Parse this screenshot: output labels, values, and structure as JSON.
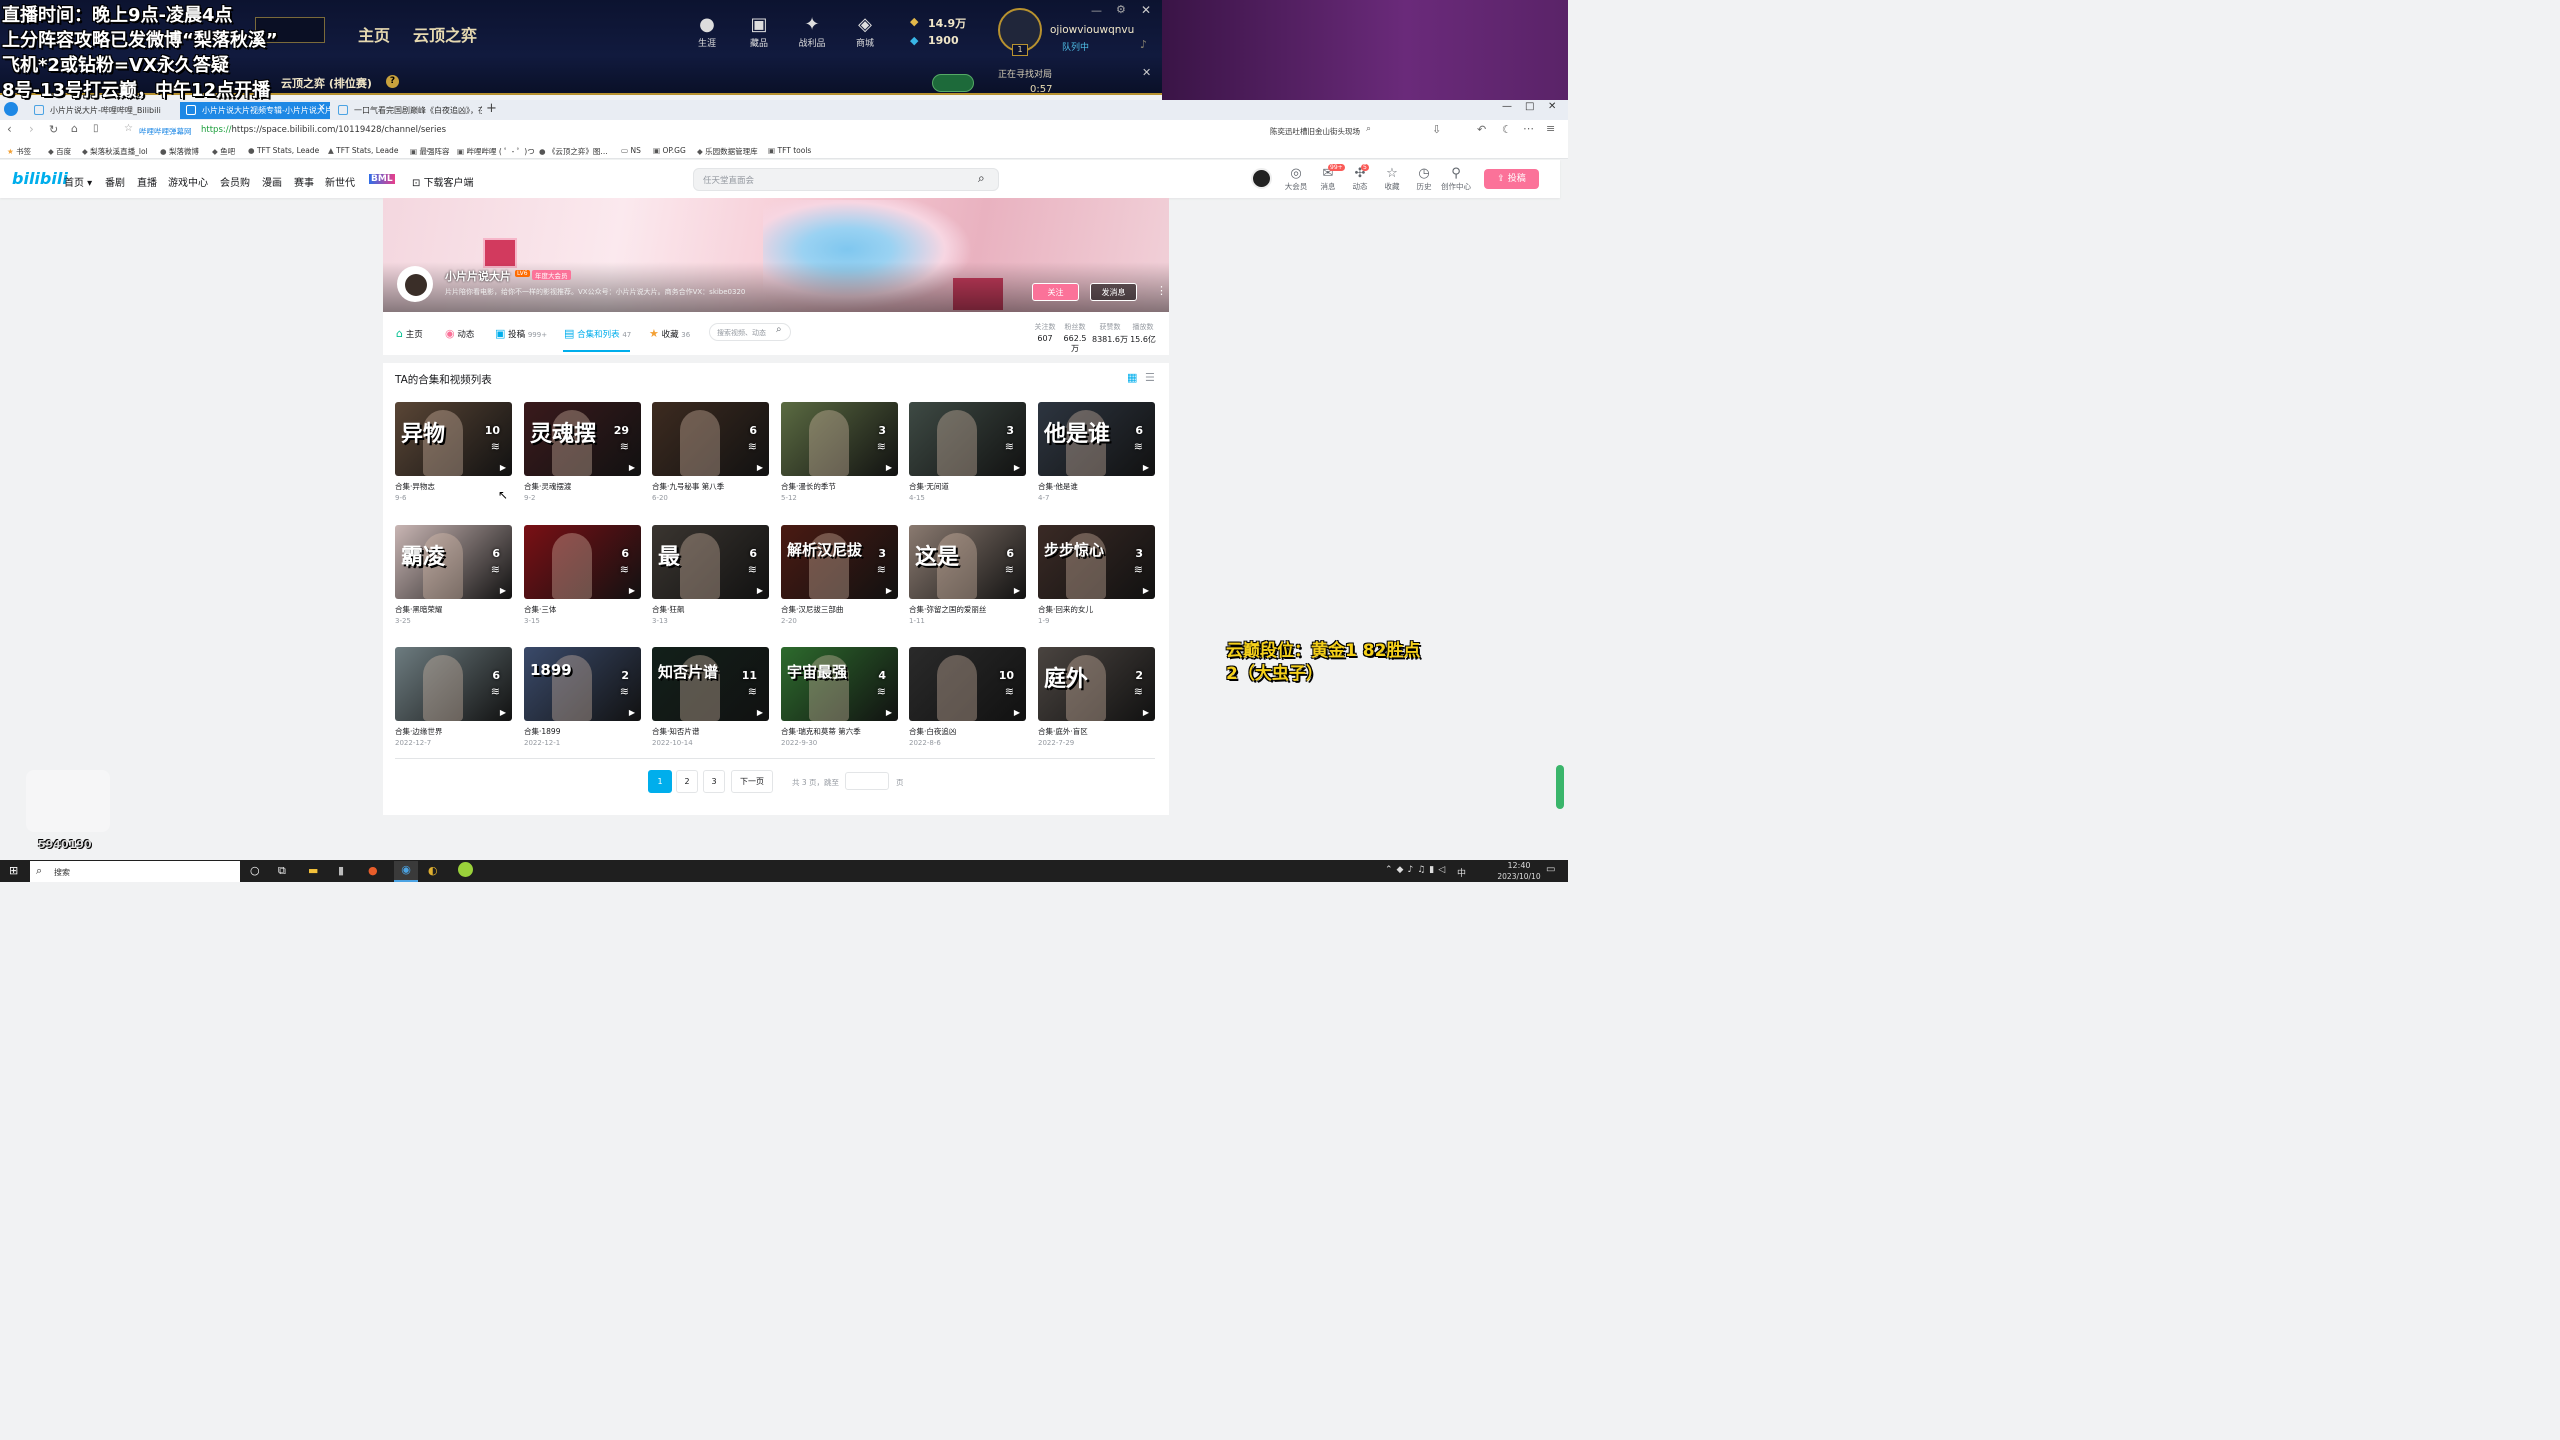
{
  "overlay": {
    "line1": "直播时间：晚上9点-凌晨4点",
    "line2": "上分阵容攻略已发微博“梨落秋溪”",
    "line3": "飞机*2或钻粉=VX永久答疑",
    "line4": "8号-13号打云巅，中午12点开播",
    "rank": "云巅段位：黄金1 82胜点",
    "rank2": "2（大虫子）",
    "watermark_num": "5940190"
  },
  "game": {
    "nav": [
      "主页",
      "云顶之弈"
    ],
    "icons": [
      {
        "label": "生涯",
        "icon": "person-icon"
      },
      {
        "label": "藏品",
        "icon": "chest-icon"
      },
      {
        "label": "战利品",
        "icon": "loot-icon"
      },
      {
        "label": "商城",
        "icon": "shop-icon"
      }
    ],
    "currency1": "14.9万",
    "currency2": "1900",
    "username": "ojiowviouwqnvu",
    "status": "队列中",
    "level": "1",
    "mode": "云顶之弈 (排位赛)",
    "searching": "正在寻找对局",
    "timer": "0:57"
  },
  "browser": {
    "tabs": [
      "小片片说大片-哔哩哔哩_Bilibili",
      "小片片说大片视频专辑-小片片说大片",
      "一口气看完国剧巅峰《白夜追凶》，在..."
    ],
    "site_label": "哔哩哔哩弹幕网",
    "url": "https://space.bilibili.com/10119428/channel/series",
    "search_hint": "陈奕迅吐槽旧金山街头现场",
    "bookmarks": [
      "书签",
      "百度",
      "梨落秋溪直播_lol",
      "梨落微博",
      "鱼吧",
      "TFT Stats, Leade",
      "TFT Stats, Leade",
      "最强阵容",
      "哔哩哔哩 ( ゜- ゜)つ",
      "《云顶之弈》图...",
      "NS",
      "OP.GG",
      "乐园数据管理库",
      "TFT tools"
    ]
  },
  "bili": {
    "logo": "bilibili",
    "nav": [
      "首页",
      "番剧",
      "直播",
      "游戏中心",
      "会员购",
      "漫画",
      "赛事",
      "新世代",
      "BML",
      "下载客户端"
    ],
    "search_placeholder": "任天堂直面会",
    "icons": [
      {
        "label": "大会员",
        "icon": "vip-icon"
      },
      {
        "label": "消息",
        "icon": "message-icon",
        "badge": "99+"
      },
      {
        "label": "动态",
        "icon": "dynamic-icon",
        "badge": "5"
      },
      {
        "label": "收藏",
        "icon": "star-icon"
      },
      {
        "label": "历史",
        "icon": "history-icon"
      },
      {
        "label": "创作中心",
        "icon": "creator-icon"
      }
    ],
    "upload": "投稿"
  },
  "profile": {
    "name": "小片片说大片",
    "level": "LV6",
    "vip": "年度大会员",
    "sign": "片片陪你看电影，给你不一样的影视推荐。VX公众号：小片片说大片。商务合作VX：skibe0320",
    "follow": "关注",
    "message": "发消息"
  },
  "space_nav": [
    {
      "label": "主页",
      "count": ""
    },
    {
      "label": "动态",
      "count": ""
    },
    {
      "label": "投稿",
      "count": "999+"
    },
    {
      "label": "合集和列表",
      "count": "47"
    },
    {
      "label": "收藏",
      "count": "36"
    }
  ],
  "space_search": "搜索视频、动态",
  "stats": [
    {
      "label": "关注数",
      "value": "607"
    },
    {
      "label": "粉丝数",
      "value": "662.5万"
    },
    {
      "label": "获赞数",
      "value": "8381.6万"
    },
    {
      "label": "播放数",
      "value": "15.6亿"
    }
  ],
  "section_title": "TA的合集和视频列表",
  "collections": [
    {
      "title": "合集·异物志",
      "date": "9-6",
      "count": "10",
      "text": "异物",
      "color": "#5a4636"
    },
    {
      "title": "合集·灵魂摆渡",
      "date": "9-2",
      "count": "29",
      "text": "灵魂摆",
      "color": "#3a1a1c"
    },
    {
      "title": "合集·九号秘事 第八季",
      "date": "6-20",
      "count": "6",
      "text": "",
      "color": "#3d2b20"
    },
    {
      "title": "合集·漫长的季节",
      "date": "5-12",
      "count": "3",
      "text": "",
      "color": "#5b6b42"
    },
    {
      "title": "合集·无间道",
      "date": "4-15",
      "count": "3",
      "text": "",
      "color": "#3e4a44"
    },
    {
      "title": "合集·他是谁",
      "date": "4-7",
      "count": "6",
      "text": "他是谁",
      "color": "#2d3540"
    },
    {
      "title": "合集·黑暗荣耀",
      "date": "3-25",
      "count": "6",
      "text": "霸凌",
      "color": "#c9b6b4"
    },
    {
      "title": "合集·三体",
      "date": "3-15",
      "count": "6",
      "text": "",
      "color": "#7a1015"
    },
    {
      "title": "合集·狂飙",
      "date": "3-13",
      "count": "6",
      "text": "最",
      "color": "#3a3530"
    },
    {
      "title": "合集·汉尼拔三部曲",
      "date": "2-20",
      "count": "3",
      "text": "解析汉尼拔",
      "color": "#4a1a12"
    },
    {
      "title": "合集·弥留之国的爱丽丝",
      "date": "1-11",
      "count": "6",
      "text": "这是",
      "color": "#8a7a70"
    },
    {
      "title": "合集·回来的女儿",
      "date": "1-9",
      "count": "3",
      "text": "步步惊心",
      "color": "#3a2a25"
    },
    {
      "title": "合集·边缘世界",
      "date": "2022-12-7",
      "count": "6",
      "text": "",
      "color": "#6d7c80"
    },
    {
      "title": "合集·1899",
      "date": "2022-12-1",
      "count": "2",
      "text": "1899",
      "color": "#3a4a6a"
    },
    {
      "title": "合集·知否片谱",
      "date": "2022-10-14",
      "count": "11",
      "text": "知否片谱",
      "color": "#12201a"
    },
    {
      "title": "合集·瑞克和莫蒂 第六季",
      "date": "2022-9-30",
      "count": "4",
      "text": "宇宙最强",
      "color": "#2d6b2d"
    },
    {
      "title": "合集·白夜追凶",
      "date": "2022-8-6",
      "count": "10",
      "text": "",
      "color": "#2a2a2a"
    },
    {
      "title": "合集·庭外·盲区",
      "date": "2022-7-29",
      "count": "2",
      "text": "庭外",
      "color": "#4a4440"
    }
  ],
  "pagination": {
    "pages": [
      "1",
      "2",
      "3"
    ],
    "next": "下一页",
    "total": "共 3 页，跳至",
    "unit": "页"
  },
  "taskbar": {
    "search": "搜索",
    "time": "12:40",
    "date": "2023/10/10",
    "ime": "中"
  }
}
